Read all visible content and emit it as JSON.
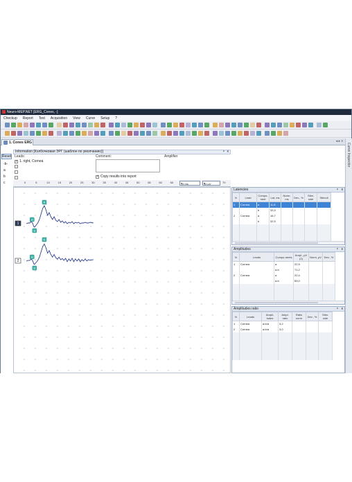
{
  "window": {
    "title": "Neuro-MEP.NET [ERG_Cones, -]"
  },
  "menu": [
    "Checkup",
    "Report",
    "Test",
    "Acquisition",
    "View",
    "Curve",
    "Setup",
    "?"
  ],
  "toolbar_colors": [
    "#5c7fb8",
    "#3f9a4d",
    "#d8a13c",
    "#b94b4b",
    "#7b63b0",
    "#3b8fb0"
  ],
  "tab": {
    "label": "1. Cones ERG",
    "controls": "◂ ▸ x"
  },
  "side_panel": {
    "label": "Curve Inspector"
  },
  "info": {
    "title": "Information [Колбочковая ЭРГ (шаблон по умолчанию)]",
    "reset_label": "Reset",
    "leads_header": "Leads:",
    "comment_header": "Comment:",
    "amplifier_header": "Amplifier",
    "lead_label": "1. right, Cornea",
    "copy_label": "Copy results into report",
    "left_markers": [
      "-b-",
      "a",
      "b",
      "c"
    ]
  },
  "ruler": {
    "ticks": [
      "0",
      "5",
      "10",
      "15",
      "20",
      "25",
      "30",
      "35",
      "40",
      "45",
      "50",
      "55",
      "60",
      "65",
      "70"
    ],
    "sweep": "15 ms",
    "sens": "40 µV"
  },
  "traces": [
    {
      "label": "1",
      "label_active": true,
      "markers": [
        "a",
        "b",
        "a"
      ]
    },
    {
      "label": "2",
      "label_active": false,
      "markers": [
        "a",
        "b",
        "a"
      ]
    }
  ],
  "latencies": {
    "title": "Latencies",
    "headers": [
      "N",
      "Lead",
      "Compo-nent",
      "Lat, ms",
      "Norm, ms",
      "Dev., %",
      "Stim. side",
      "Stimuli"
    ],
    "rows": [
      [
        "1",
        "Cornea",
        "a",
        "11,8",
        "",
        "",
        "",
        ""
      ],
      [
        "",
        "",
        "b",
        "33,3",
        "",
        "",
        "",
        ""
      ],
      [
        "2",
        "Cornea",
        "a",
        "16,7",
        "",
        "",
        "",
        ""
      ],
      [
        "",
        "",
        "b",
        "32,5",
        "",
        "",
        "",
        ""
      ]
    ]
  },
  "amplitudes": {
    "title": "Amplitudes",
    "headers": [
      "N",
      "Leads",
      "Compo-nents",
      "Ampl., µV (2)",
      "Norm, µV",
      "Dev., %"
    ],
    "rows": [
      [
        "1",
        "Cornea",
        "a",
        "22,5",
        "",
        ""
      ],
      [
        "",
        "",
        "a-b",
        "71,2",
        "",
        ""
      ],
      [
        "2",
        "Cornea",
        "a",
        "22,4",
        "",
        ""
      ],
      [
        "",
        "",
        "a-b",
        "69,0",
        "",
        ""
      ]
    ]
  },
  "ratio": {
    "title": "Amplitudes ratio",
    "headers": [
      "N",
      "Leads",
      "Ampli-tudes",
      "Ampl. ratio",
      "Ratio norm",
      "Dev., %",
      "Stim. side"
    ],
    "rows": [
      [
        "1",
        "Cornea",
        "a-b/a",
        "3,2",
        "",
        "",
        ""
      ],
      [
        "2",
        "Cornea",
        "a-b/a",
        "3,0",
        "",
        "",
        ""
      ]
    ]
  },
  "pane_controls": {
    "pin": "ᵖ",
    "close": "x"
  }
}
